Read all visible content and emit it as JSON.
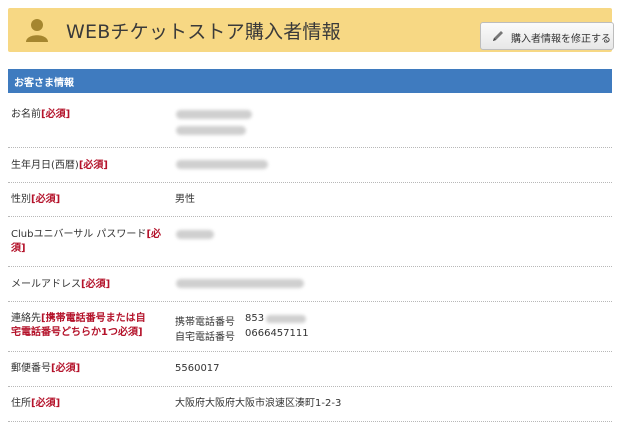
{
  "header": {
    "title": "WEBチケットストア購入者情報",
    "edit_button_label": "購入者情報を修正する",
    "bg_color": "#f7d884"
  },
  "section": {
    "title": "お客さま情報",
    "color": "#3f7bbf"
  },
  "required_mark": "[必須]",
  "rows": {
    "name": {
      "label": "お名前"
    },
    "birthday": {
      "label": "生年月日(西暦)"
    },
    "gender": {
      "label": "性別",
      "value": "男性"
    },
    "password": {
      "label_line1": "Clubユニバーサル パスワード",
      "label_req1": "[必",
      "label_req2": "須]"
    },
    "email": {
      "label": "メールアドレス"
    },
    "contact": {
      "label_prefix": "連絡先",
      "label_req_line1": "[携帯電話番号または自",
      "label_req_line2": "宅電話番号どちらか1つ必須]",
      "mobile_label": "携帯電話番号",
      "mobile_value": "853",
      "home_label": "自宅電話番号",
      "home_value": "0666457111"
    },
    "postal": {
      "label": "郵便番号",
      "value": "5560017"
    },
    "address": {
      "label": "住所",
      "value": "大阪府大阪府大阪市浪速区湊町1-2-3"
    }
  },
  "icons": [
    "person-icon",
    "pencil-icon"
  ],
  "required_color": "#b4122a"
}
